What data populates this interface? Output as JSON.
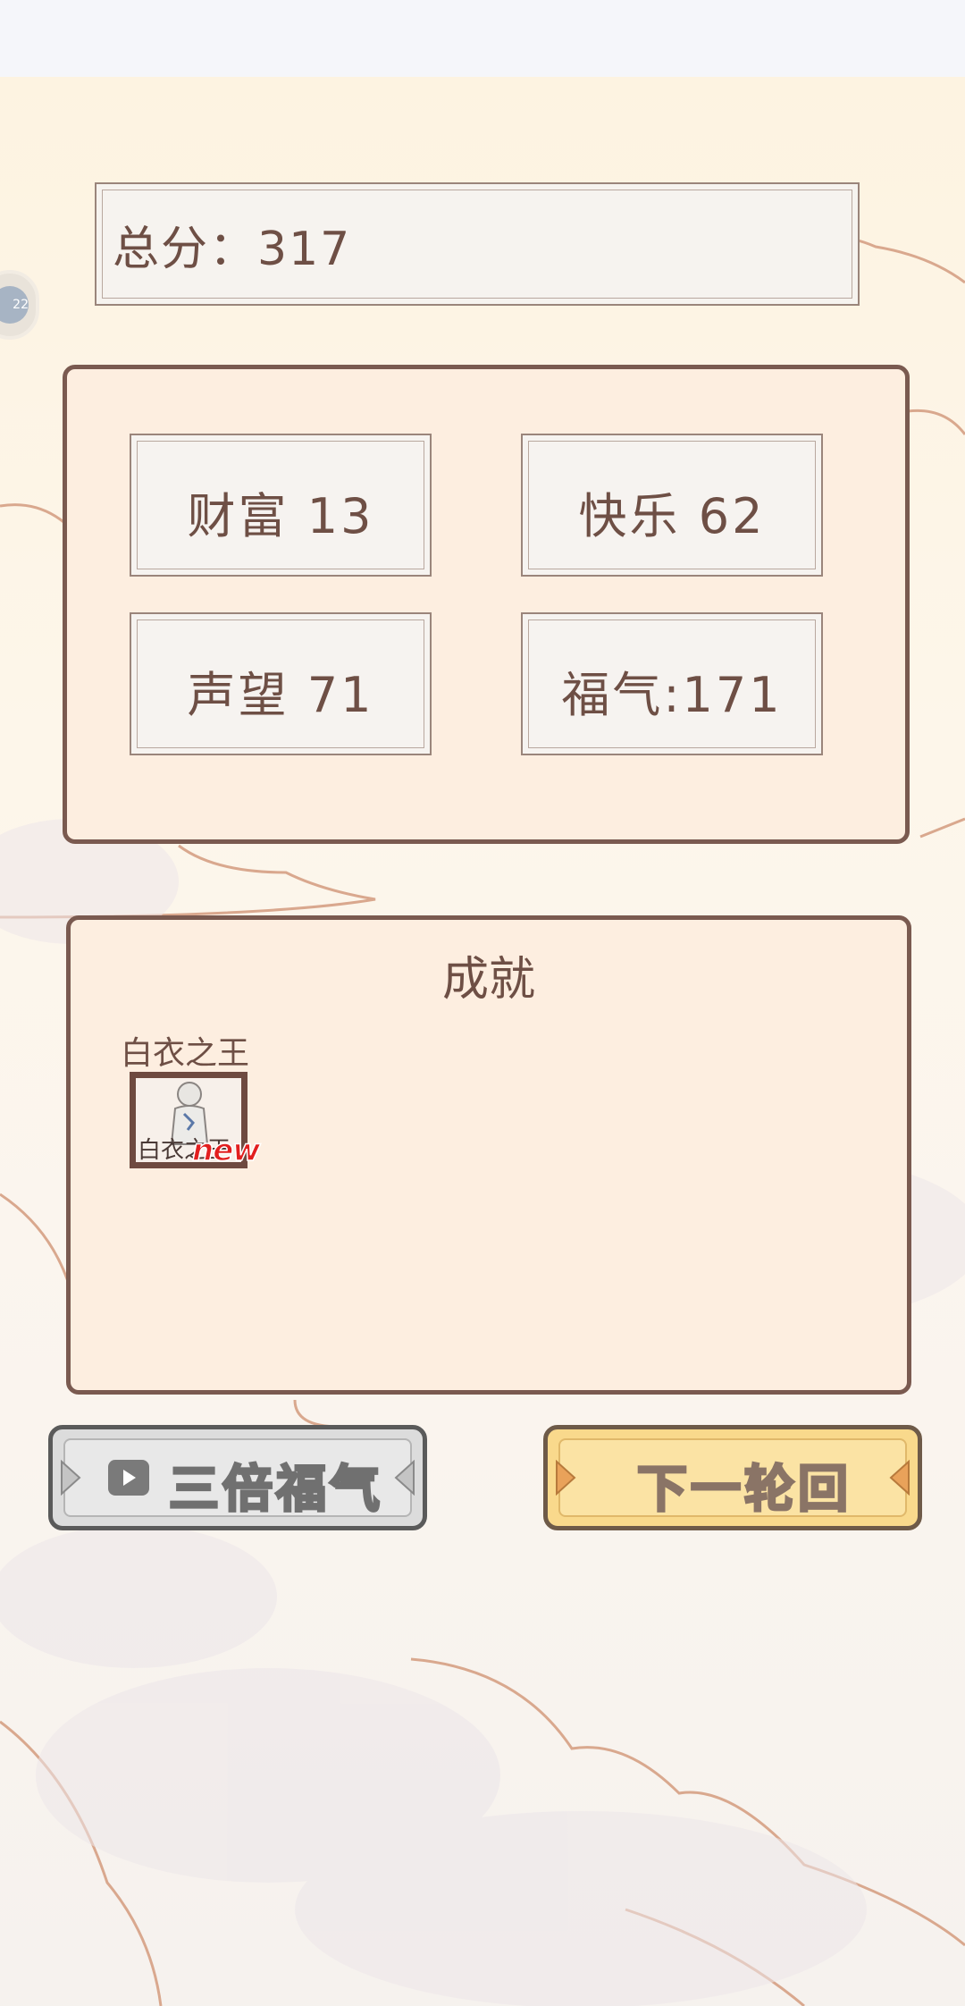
{
  "score": {
    "text": "总分：317"
  },
  "stats": [
    {
      "label": "财富  13"
    },
    {
      "label": "快乐  62"
    },
    {
      "label": "声望  71"
    },
    {
      "label": "福气:171"
    }
  ],
  "achievements": {
    "title": "成就",
    "items": [
      {
        "name": "白衣之王",
        "badge_label": "白衣之王",
        "tag": "new"
      }
    ]
  },
  "buttons": {
    "triple_label": "三倍福气",
    "next_label": "下一轮回"
  },
  "side_bubble": {
    "text": "22"
  },
  "icons": {
    "video": "video-icon",
    "arrow": "arrow-icon"
  },
  "colors": {
    "panel_fill": "#fdeee0",
    "panel_border": "#7a5a50",
    "text_brown": "#6e4f45",
    "next_button": "#f9d98c",
    "triple_button": "#dcdcdc",
    "new_tag": "#e21f1f"
  }
}
